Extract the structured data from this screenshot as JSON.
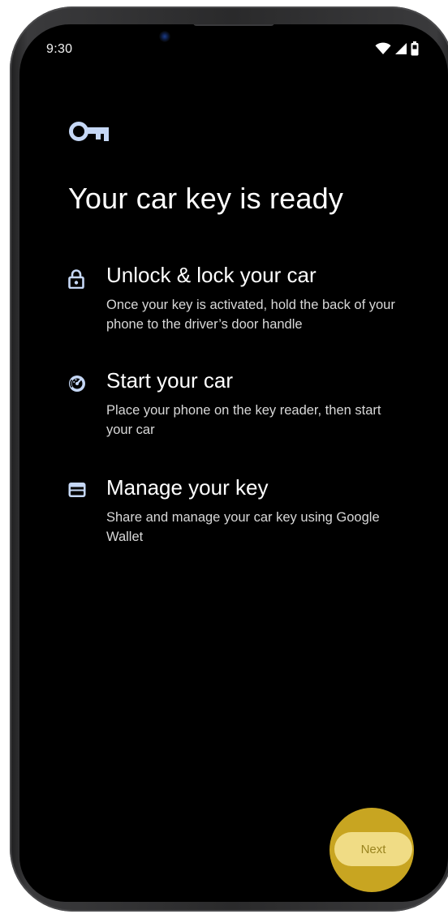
{
  "status_bar": {
    "time": "9:30",
    "icons": [
      "wifi-icon",
      "cellular-signal-icon",
      "battery-icon"
    ]
  },
  "page": {
    "hero_icon": "car-key-icon",
    "title": "Your car key is ready"
  },
  "features": [
    {
      "icon": "lock-icon",
      "title": "Unlock & lock your car",
      "description": "Once your key is activated, hold the back of your phone to the driver’s door handle"
    },
    {
      "icon": "speedometer-icon",
      "title": "Start your car",
      "description": "Place your phone on the key reader, then start your car"
    },
    {
      "icon": "wallet-icon",
      "title": "Manage your key",
      "description": "Share and manage your car key using Google Wallet"
    }
  ],
  "actions": {
    "next_label": "Next"
  },
  "colors": {
    "background": "#000000",
    "icon_accent": "#c5d7f5",
    "next_button_bg": "#f0dc85",
    "next_button_text": "#9a8420",
    "highlight": "#c8a521"
  }
}
